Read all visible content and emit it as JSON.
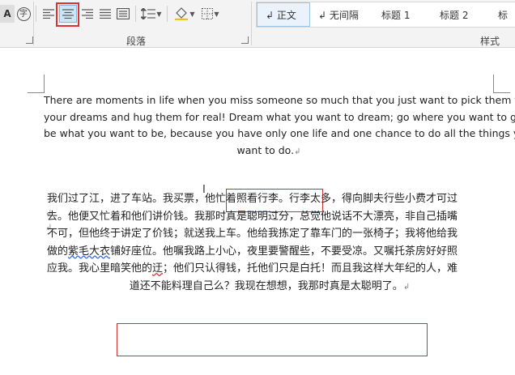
{
  "ribbon": {
    "toolbar_left": {
      "font_size_a": "A",
      "phonetic": "字"
    },
    "paragraph_group_label": "段落",
    "styles_group_label": "样式",
    "styles": [
      {
        "label": "↲ 正文",
        "selected": true
      },
      {
        "label": "↲ 无间隔",
        "selected": false
      },
      {
        "label": "标题 1",
        "selected": false
      },
      {
        "label": "标题 2",
        "selected": false
      },
      {
        "label": "标",
        "selected": false
      }
    ]
  },
  "document": {
    "english_lines": [
      "There are moments in life when you miss someone so much that you just want to pick them from",
      "your dreams and hug them for real! Dream what you want to dream; go where you want to go;",
      "be what you want to be, because you have only one life and one chance to do all the things you",
      "want to do."
    ],
    "paragraph_mark": "↲",
    "chinese_lines": [
      "我们过了江，进了车站。我买票，他忙着照看行李。行李太多，得向脚夫行些小费才可过",
      "去。他便又忙着和他们讲价钱。我那时真是聪明过分，总觉他说话不大漂亮，非自己插嘴",
      "不可，但他终于讲定了价钱；就送我上车。他给我拣定了靠车门的一张椅子；我将他给我",
      "做的紫毛大衣铺好座位。他嘱我路上小心，夜里要警醒些，不要受凉。又嘱托茶房好好照",
      "应我。我心里暗笑他的迂；他们只认得钱，托他们只是白托！而且我这样大年纪的人，难",
      "道还不能料理自己么？我现在想想，我那时真是太聪明了。"
    ],
    "chinese_line4_parts": [
      "做的",
      "紫毛大衣",
      "铺好座位。他嘱我路上小心，夜里要警醒些，不要受凉。又嘱托茶房好好照"
    ],
    "chinese_line5_parts": [
      "应我。我心里暗笑他的",
      "迂",
      "；他们只认得钱，托他们只是白托！而且我这样大年纪的人，难"
    ]
  },
  "colors": {
    "highlight_box": "#e03131",
    "selected_button": "#cde6f7",
    "ribbon_bg": "#f3f3f3"
  }
}
